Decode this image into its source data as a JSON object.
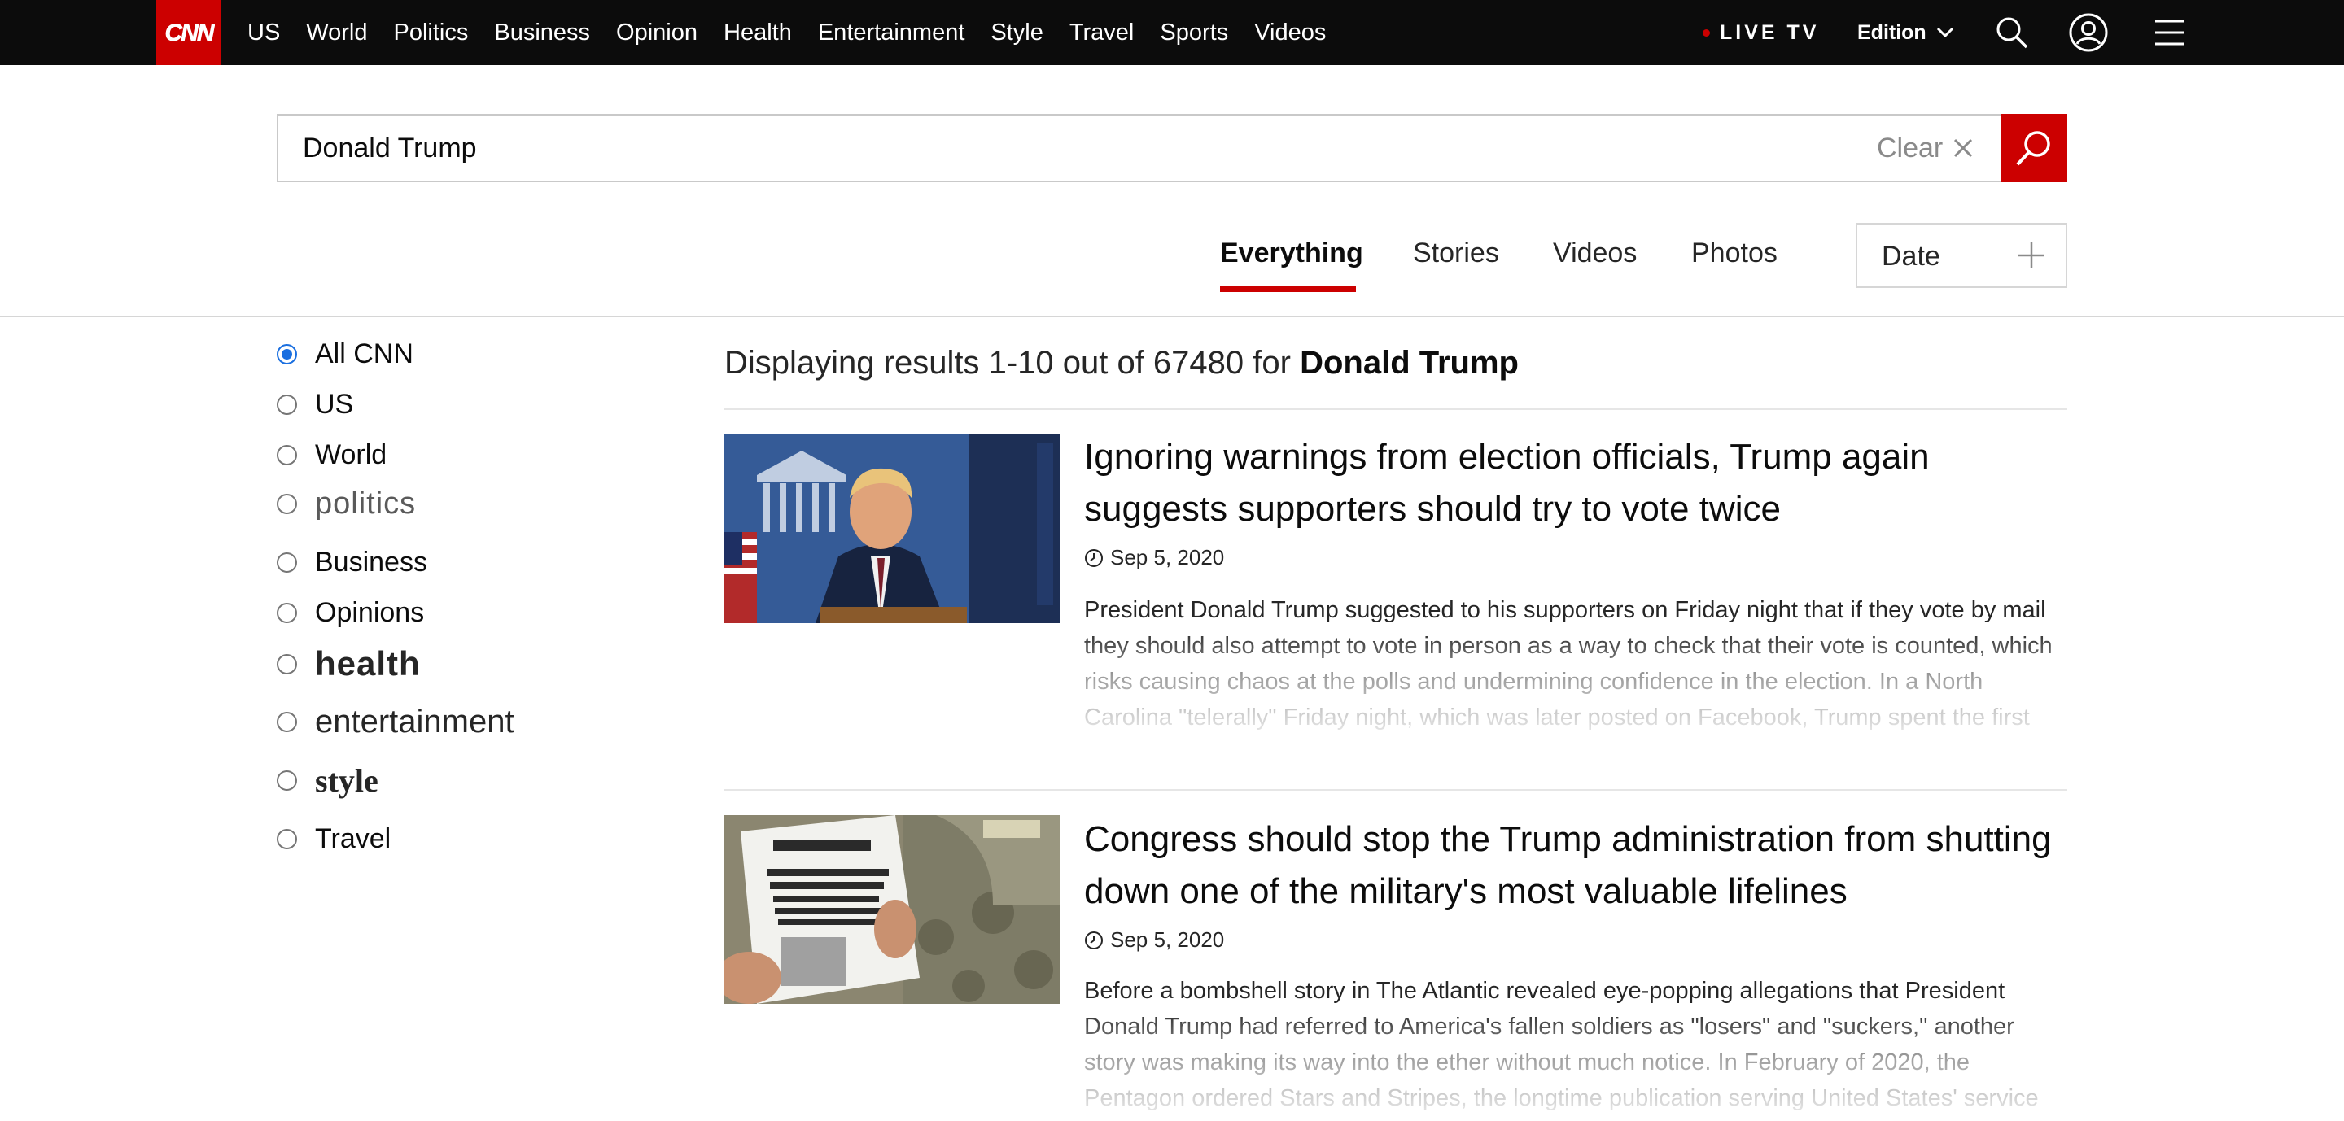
{
  "nav": {
    "logo_text": "CNN",
    "items": [
      "US",
      "World",
      "Politics",
      "Business",
      "Opinion",
      "Health",
      "Entertainment",
      "Style",
      "Travel",
      "Sports",
      "Videos"
    ],
    "live_tv": "LIVE TV",
    "edition": "Edition",
    "icons": [
      "search-icon",
      "account-icon",
      "menu-icon"
    ]
  },
  "search": {
    "value": "Donald Trump",
    "clear_label": "Clear"
  },
  "tabs": [
    {
      "label": "Everything",
      "active": true
    },
    {
      "label": "Stories",
      "active": false
    },
    {
      "label": "Videos",
      "active": false
    },
    {
      "label": "Photos",
      "active": false
    }
  ],
  "date_filter": {
    "label": "Date"
  },
  "filters": [
    {
      "label": "All CNN",
      "checked": true
    },
    {
      "label": "US",
      "checked": false
    },
    {
      "label": "World",
      "checked": false
    },
    {
      "label": "politics",
      "checked": false
    },
    {
      "label": "Business",
      "checked": false
    },
    {
      "label": "Opinions",
      "checked": false
    },
    {
      "label": "health",
      "checked": false
    },
    {
      "label": "entertainment",
      "checked": false
    },
    {
      "label": "style",
      "checked": false
    },
    {
      "label": "Travel",
      "checked": false
    }
  ],
  "summary": {
    "prefix": "Displaying results 1-10 out of 67480 for",
    "query": "Donald Trump"
  },
  "results": [
    {
      "headline": "Ignoring warnings from election officials, Trump again suggests supporters should try to vote twice",
      "date": "Sep 5, 2020",
      "excerpt": "President Donald Trump suggested to his supporters on Friday night that if they vote by mail they should also attempt to vote in person as a way to check that their vote is counted, which risks causing chaos at the polls and undermining confidence in the election. In a North Carolina \"telerally\" Friday night, which was later posted on Facebook, Trump spent the first"
    },
    {
      "headline": "Congress should stop the Trump administration from shutting down one of the military's most valuable lifelines",
      "date": "Sep 5, 2020",
      "excerpt": "Before a bombshell story in The Atlantic revealed eye-popping allegations that President Donald Trump had referred to America's fallen soldiers as \"losers\" and \"suckers,\" another story was making its way into the ether without much notice. In February of 2020, the Pentagon ordered Stars and Stripes, the longtime publication serving United States' service"
    }
  ],
  "colors": {
    "brand": "#cc0000",
    "nav_bg": "#0c0c0c",
    "radio_active": "#1a6fe0"
  }
}
